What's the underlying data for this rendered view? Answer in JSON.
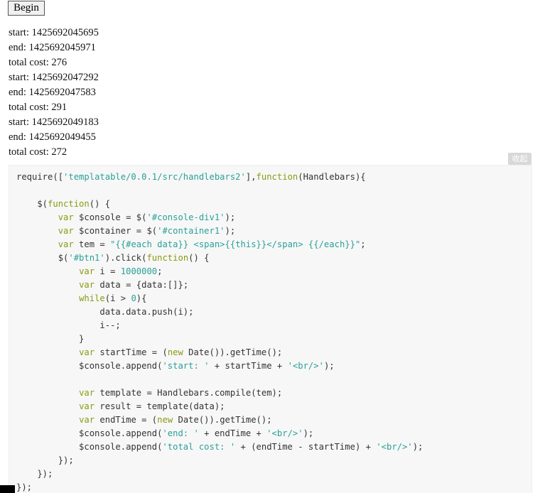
{
  "begin_button": "Begin",
  "console": [
    "start: 1425692045695",
    "end: 1425692045971",
    "total cost: 276",
    "start: 1425692047292",
    "end: 1425692047583",
    "total cost: 291",
    "start: 1425692049183",
    "end: 1425692049455",
    "total cost: 272"
  ],
  "collapse_label": "收起",
  "code_lines": [
    [
      [
        "p",
        "require(["
      ],
      [
        "s",
        "'templatable/0.0.1/src/handlebars2'"
      ],
      [
        "p",
        "],"
      ],
      [
        "k",
        "function"
      ],
      [
        "p",
        "(Handlebars){"
      ]
    ],
    [],
    [
      [
        "p",
        "    $("
      ],
      [
        "k",
        "function"
      ],
      [
        "p",
        "() {"
      ]
    ],
    [
      [
        "p",
        "        "
      ],
      [
        "k",
        "var"
      ],
      [
        "p",
        " $console = $("
      ],
      [
        "s",
        "'#console-div1'"
      ],
      [
        "p",
        ");"
      ]
    ],
    [
      [
        "p",
        "        "
      ],
      [
        "k",
        "var"
      ],
      [
        "p",
        " $container = $("
      ],
      [
        "s",
        "'#container1'"
      ],
      [
        "p",
        ");"
      ]
    ],
    [
      [
        "p",
        "        "
      ],
      [
        "k",
        "var"
      ],
      [
        "p",
        " tem = "
      ],
      [
        "s",
        "\"{{#each data}} <span>{{this}}</span> {{/each}}\""
      ],
      [
        "p",
        ";"
      ]
    ],
    [
      [
        "p",
        "        $("
      ],
      [
        "s",
        "'#btn1'"
      ],
      [
        "p",
        ").click("
      ],
      [
        "k",
        "function"
      ],
      [
        "p",
        "() {"
      ]
    ],
    [
      [
        "p",
        "            "
      ],
      [
        "k",
        "var"
      ],
      [
        "p",
        " i = "
      ],
      [
        "n",
        "1000000"
      ],
      [
        "p",
        ";"
      ]
    ],
    [
      [
        "p",
        "            "
      ],
      [
        "k",
        "var"
      ],
      [
        "p",
        " data = {data:[]};"
      ]
    ],
    [
      [
        "p",
        "            "
      ],
      [
        "k",
        "while"
      ],
      [
        "p",
        "(i > "
      ],
      [
        "n",
        "0"
      ],
      [
        "p",
        "){"
      ]
    ],
    [
      [
        "p",
        "                data.data.push(i);"
      ]
    ],
    [
      [
        "p",
        "                i--;"
      ]
    ],
    [
      [
        "p",
        "            }"
      ]
    ],
    [
      [
        "p",
        "            "
      ],
      [
        "k",
        "var"
      ],
      [
        "p",
        " startTime = ("
      ],
      [
        "k",
        "new"
      ],
      [
        "p",
        " Date()).getTime();"
      ]
    ],
    [
      [
        "p",
        "            $console.append("
      ],
      [
        "s",
        "'start: '"
      ],
      [
        "p",
        " + startTime + "
      ],
      [
        "s",
        "'<br/>'"
      ],
      [
        "p",
        ");"
      ]
    ],
    [],
    [
      [
        "p",
        "            "
      ],
      [
        "k",
        "var"
      ],
      [
        "p",
        " template = Handlebars.compile(tem);"
      ]
    ],
    [
      [
        "p",
        "            "
      ],
      [
        "k",
        "var"
      ],
      [
        "p",
        " result = template(data);"
      ]
    ],
    [
      [
        "p",
        "            "
      ],
      [
        "k",
        "var"
      ],
      [
        "p",
        " endTime = ("
      ],
      [
        "k",
        "new"
      ],
      [
        "p",
        " Date()).getTime();"
      ]
    ],
    [
      [
        "p",
        "            $console.append("
      ],
      [
        "s",
        "'end: '"
      ],
      [
        "p",
        " + endTime + "
      ],
      [
        "s",
        "'<br/>'"
      ],
      [
        "p",
        ");"
      ]
    ],
    [
      [
        "p",
        "            $console.append("
      ],
      [
        "s",
        "'total cost: '"
      ],
      [
        "p",
        " + (endTime - startTime) + "
      ],
      [
        "s",
        "'<br/>'"
      ],
      [
        "p",
        ");"
      ]
    ],
    [
      [
        "p",
        "        });"
      ]
    ],
    [
      [
        "p",
        "    });"
      ]
    ],
    [
      [
        "p",
        "});"
      ]
    ]
  ]
}
